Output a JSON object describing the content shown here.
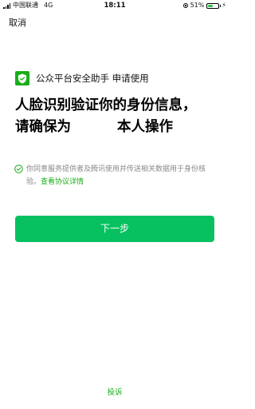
{
  "status_bar": {
    "carrier": "中国联通",
    "network": "4G",
    "time": "18:11",
    "battery_percent": "51%",
    "battery_level": 0.51,
    "battery_color": "#32c14f"
  },
  "nav": {
    "cancel_label": "取消"
  },
  "service": {
    "icon": "shield-check-icon",
    "name": "公众平台安全助手 申请使用"
  },
  "headline": {
    "line1": "人脸识别验证你的身份信息，",
    "line2_prefix": "请确保为",
    "line2_suffix": "本人操作"
  },
  "consent": {
    "text": "你同意服务提供者及腾讯使用并传送相关数据用于身份核验。",
    "link": "查看协议详情"
  },
  "primary_button": {
    "label": "下一步",
    "color": "#07c160"
  },
  "footer": {
    "complaint_label": "投诉"
  },
  "colors": {
    "accent": "#1aad19",
    "secondary_text": "#888888"
  }
}
